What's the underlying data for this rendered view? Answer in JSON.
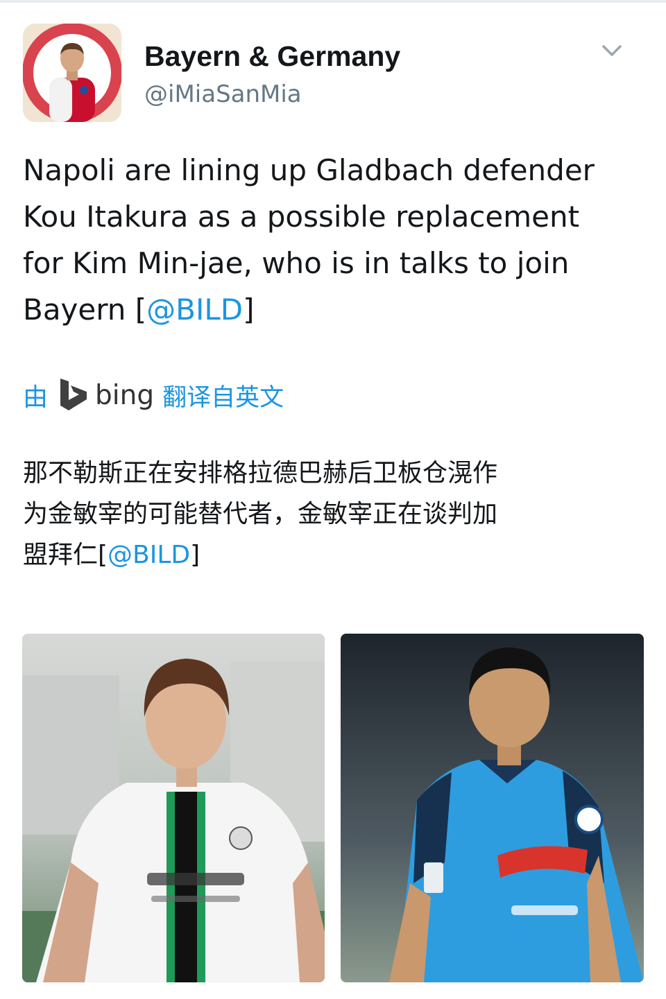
{
  "author": {
    "display_name": "Bayern & Germany",
    "handle": "@iMiaSanMia",
    "avatar_icon": "player-in-bayern-jersey-avatar"
  },
  "tweet": {
    "text_lines": [
      "Napoli are lining up Gladbach defender",
      "Kou Itakura as a possible replacement",
      "for Kim Min-jae, who is in talks to join"
    ],
    "last_line_prefix": "Bayern [",
    "mention": "@BILD",
    "last_line_suffix": "]"
  },
  "translation": {
    "by_label": "由",
    "service_icon": "bing-logo-icon",
    "service_name": "bing",
    "from_label": "翻译自英文",
    "text_lines": [
      "那不勒斯正在安排格拉德巴赫后卫板仓滉作",
      "为金敏宰的可能替代者，金敏宰正在谈判加"
    ],
    "last_line_prefix": "盟拜仁[",
    "mention": "@BILD",
    "last_line_suffix": "]"
  },
  "media": [
    {
      "icon": "player-photo-white-green-kit"
    },
    {
      "icon": "player-photo-blue-kit"
    }
  ],
  "colors": {
    "link": "#1b95e0",
    "text": "#14171a",
    "secondary": "#657786"
  }
}
